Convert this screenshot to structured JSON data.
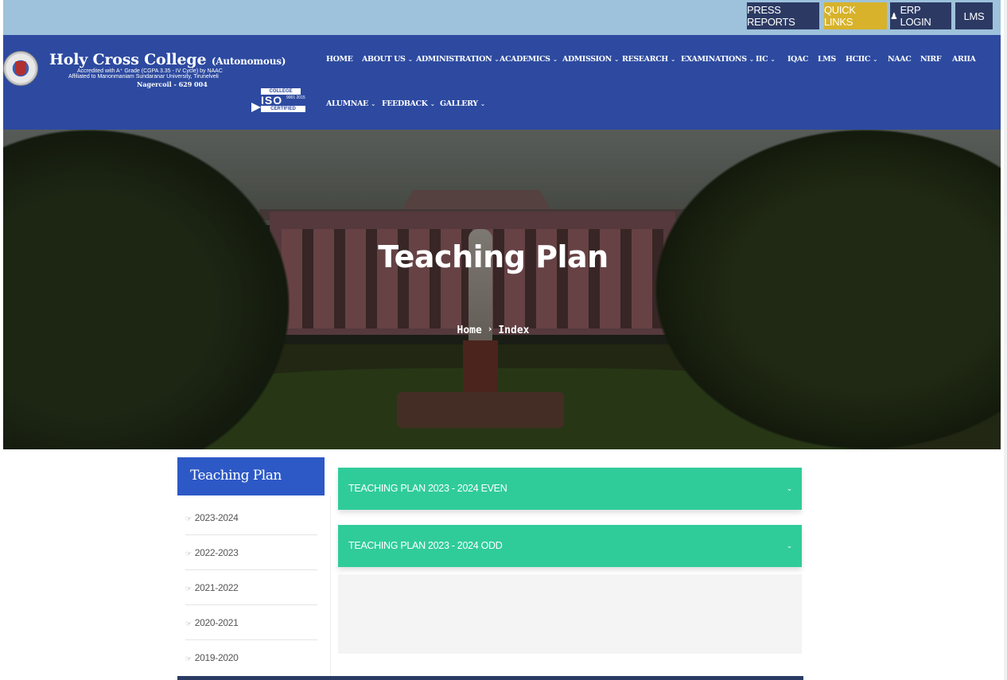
{
  "topbar": {
    "press_reports": "PRESS REPORTS",
    "quick_links": "QUICK LINKS",
    "erp_login": "ERP LOGIN",
    "lms": "LMS"
  },
  "brand": {
    "name": "Holy Cross College",
    "suffix": "(Autonomous)",
    "accreditation": "Accredited with A⁺ Grade (CGPA 3.35 - IV Cycle) by NAAC",
    "affiliation": "Affiliated to Manonmaniam Sundaranar University, Tirunelveli",
    "location": "Nagercoil - 629 004",
    "iso": {
      "top": "COLLEGE",
      "mark": "ISO",
      "number": "9001 2015",
      "bottom": "CERTIFIED"
    }
  },
  "nav": {
    "row1": [
      "HOME",
      "ABOUT US",
      "ADMINISTRATION",
      "ACADEMICS",
      "ADMISSION",
      "RESEARCH",
      "EXAMINATIONS",
      "IIC",
      "IQAC",
      "LMS",
      "HCIIC",
      "NAAC",
      "NIRF",
      "ARIIA"
    ],
    "row2": [
      "ALUMNAE",
      "FEEDBACK",
      "GALLERY"
    ]
  },
  "hero": {
    "title": "Teaching Plan",
    "breadcrumb_home": "Home",
    "breadcrumb_current": "Index"
  },
  "sidebar": {
    "title": "Teaching Plan",
    "items": [
      "2023-2024",
      "2022-2023",
      "2021-2022",
      "2020-2021",
      "2019-2020"
    ]
  },
  "accordion": {
    "items": [
      "TEACHING PLAN 2023 - 2024 EVEN",
      "TEACHING PLAN 2023 - 2024 ODD"
    ]
  },
  "colors": {
    "topbar": "#9ec2db",
    "header": "#2d4aa0",
    "quick_links": "#d7b22a",
    "sidebar_head": "#2d59c6",
    "accordion": "#2fcc99"
  }
}
